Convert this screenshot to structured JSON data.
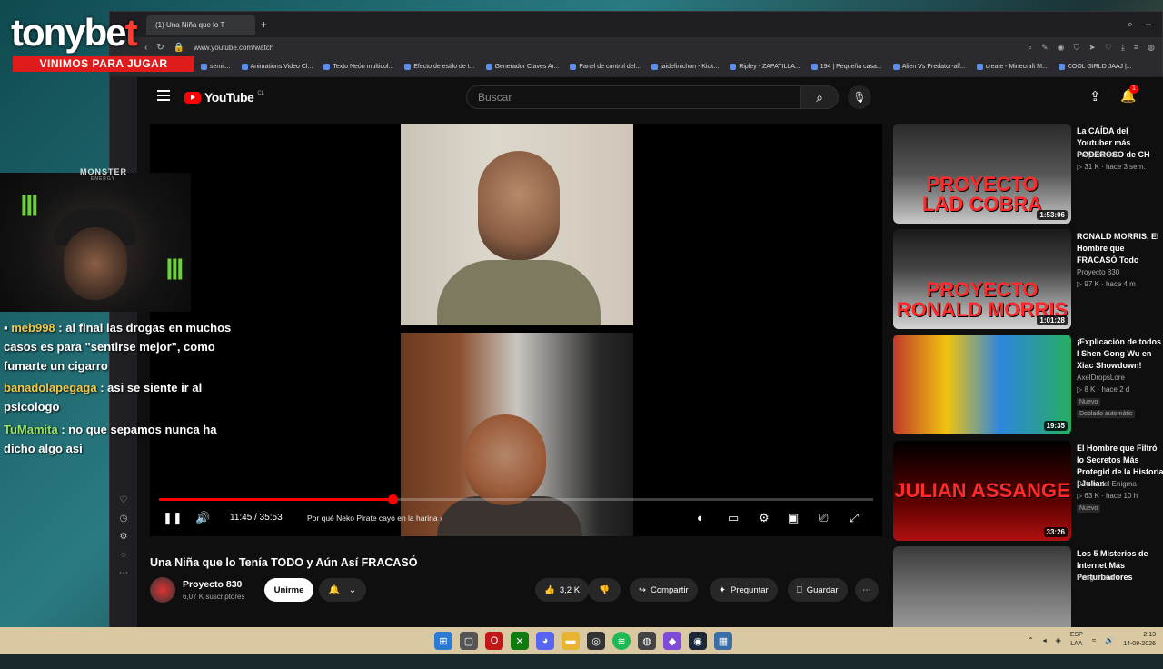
{
  "overlay": {
    "brand_main": "tonybe",
    "brand_end": "t",
    "tagline": "VINIMOS PARA JUGAR",
    "monster_text": "MONSTER",
    "monster_sub": "ENERGY"
  },
  "chat": [
    {
      "user": "meb998",
      "text": " : al final las drogas en muchos casos es para \"sentirse mejor\", como fumarte un cigarro"
    },
    {
      "user": "banadolapegaga",
      "text": " : asi se siente ir al psicologo"
    },
    {
      "user": "TuMamita",
      "text": " : no que sepamos nunca ha dicho algo asi"
    }
  ],
  "browser": {
    "tab_title": "(1) Una Niña que lo T",
    "url": "www.youtube.com/watch",
    "bookmarks": [
      "semit...",
      "Animations Video Cl...",
      "Texto Neón multicol...",
      "Efecto de estilo de t...",
      "Generador Claves Ar...",
      "Panel de control del...",
      "jaidefinichon - Kick...",
      "Ripley - ZAPATILLA...",
      "194 | Pequeña casa...",
      "Alien Vs Predator-alf...",
      "create - Minecraft M...",
      "COOL GIRLD JAAJ |..."
    ]
  },
  "youtube": {
    "logo_text": "YouTube",
    "country": "CL",
    "search_placeholder": "Buscar",
    "notif_count": "1",
    "time_current": "11:45",
    "time_sep": " / ",
    "time_total": "35:53",
    "chapter": "Por qué Neko Pirate cayó en la harina",
    "progress": 0.327,
    "video_title": "Una Niña que lo Tenía TODO y Aún Así FRACASÓ",
    "channel": "Proyecto 830",
    "subscribers": "6,07 K suscriptores",
    "join_label": "Unirme",
    "likes": "3,2 K",
    "share_label": "Compartir",
    "ask_label": "Preguntar",
    "save_label": "Guardar"
  },
  "recommendations": [
    {
      "title": "La CAÍDA del Youtuber más PODEROSO de CH",
      "channel": "Proyecto 830",
      "meta": "31 K · hace 3 sem.",
      "duration": "1:53:06",
      "thumb_text": "PROYECTO\nLAD COBRA",
      "badge": ""
    },
    {
      "title": "RONALD MORRIS, El Hombre que FRACASÓ Todo",
      "channel": "Proyecto 830",
      "meta": "97 K · hace 4 m",
      "duration": "1:01:28",
      "thumb_text": "PROYECTO\nRONALD MORRIS",
      "badge": ""
    },
    {
      "title": "¡Explicación de todos l Shen Gong Wu en Xiac Showdown!",
      "channel": "AxelDropsLore",
      "meta": "8 K · hace 2 d",
      "duration": "19:35",
      "thumb_text": "",
      "badge": "Nuevo",
      "badge2": "Doblado automátic"
    },
    {
      "title": "El Hombre que Filtró lo Secretos Más Protegid de la Historia | Julian",
      "channel": "Detrás del Enigma",
      "meta": "63 K · hace 10 h",
      "duration": "33:26",
      "thumb_text": "JULIAN ASSANGE",
      "badge": "Nuevo"
    },
    {
      "title": "Los 5 Misterios de Internet Más Perturbadores",
      "channel": "Penguinator",
      "meta": "",
      "duration": "",
      "thumb_text": "",
      "badge": ""
    }
  ],
  "taskbar": {
    "lang_top": "ESP",
    "lang_bottom": "LAA",
    "time": "2:13",
    "date": "14-08-2026"
  }
}
